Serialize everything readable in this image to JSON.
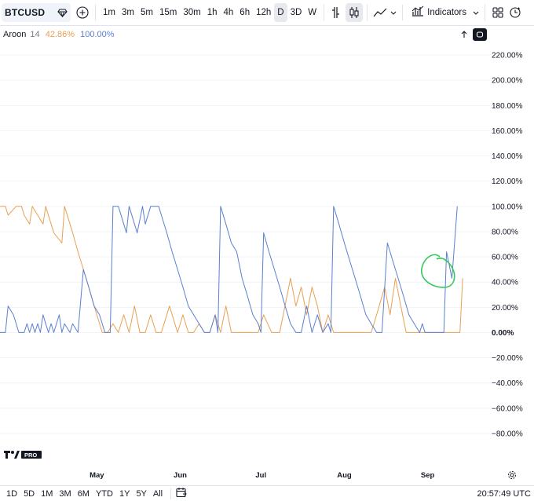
{
  "toolbar": {
    "symbol": "BTCUSD",
    "timeframes": [
      "1m",
      "3m",
      "5m",
      "15m",
      "30m",
      "1h",
      "4h",
      "6h",
      "12h",
      "D",
      "3D",
      "W"
    ],
    "active_timeframe": "D",
    "indicators_label": "Indicators"
  },
  "legend": {
    "name": "Aroon",
    "length": "14",
    "aroon_up": "42.86%",
    "aroon_down": "100.00%"
  },
  "colors": {
    "aroon_up": "#e8a052",
    "aroon_down": "#5b7fd1",
    "annotation": "#34c759",
    "grid": "#f0f3fa"
  },
  "chart_data": {
    "type": "line",
    "title": "",
    "ylim": [
      -90,
      230
    ],
    "y_ticks": [
      220,
      200,
      180,
      160,
      140,
      120,
      100,
      80,
      60,
      40,
      20,
      0,
      -20,
      -40,
      -60,
      -80
    ],
    "y_tick_labels": [
      "220.00%",
      "200.00%",
      "180.00%",
      "160.00%",
      "140.00%",
      "120.00%",
      "100.00%",
      "80.00%",
      "60.00%",
      "40.00%",
      "20.00%",
      "0.00%",
      "−20.00%",
      "−40.00%",
      "−60.00%",
      "−80.00%"
    ],
    "x_tick_labels": [
      {
        "label": "May",
        "day": 36
      },
      {
        "label": "Jun",
        "day": 67
      },
      {
        "label": "Jul",
        "day": 97
      },
      {
        "label": "Aug",
        "day": 128
      },
      {
        "label": "Sep",
        "day": 159
      }
    ],
    "x_range_days": [
      0,
      181
    ],
    "series": [
      {
        "name": "Aroon Up",
        "color": "#e8a052",
        "points": [
          [
            0,
            100
          ],
          [
            2,
            100
          ],
          [
            3,
            93
          ],
          [
            6,
            100
          ],
          [
            8,
            100
          ],
          [
            9,
            93
          ],
          [
            11,
            86
          ],
          [
            12,
            100
          ],
          [
            14,
            93
          ],
          [
            16,
            86
          ],
          [
            17,
            100
          ],
          [
            20,
            79
          ],
          [
            23,
            71
          ],
          [
            24,
            100
          ],
          [
            27,
            79
          ],
          [
            29,
            64
          ],
          [
            31,
            50
          ],
          [
            33,
            36
          ],
          [
            35,
            21
          ],
          [
            36,
            14
          ],
          [
            38,
            0
          ],
          [
            40,
            0
          ],
          [
            42,
            7
          ],
          [
            44,
            0
          ],
          [
            46,
            14
          ],
          [
            48,
            0
          ],
          [
            50,
            21
          ],
          [
            52,
            0
          ],
          [
            54,
            0
          ],
          [
            56,
            14
          ],
          [
            58,
            0
          ],
          [
            60,
            0
          ],
          [
            63,
            21
          ],
          [
            66,
            0
          ],
          [
            68,
            14
          ],
          [
            70,
            0
          ],
          [
            72,
            0
          ],
          [
            74,
            7
          ],
          [
            76,
            0
          ],
          [
            78,
            0
          ],
          [
            80,
            14
          ],
          [
            82,
            0
          ],
          [
            84,
            21
          ],
          [
            86,
            0
          ],
          [
            88,
            0
          ],
          [
            92,
            0
          ],
          [
            96,
            0
          ],
          [
            98,
            14
          ],
          [
            101,
            0
          ],
          [
            104,
            0
          ],
          [
            108,
            43
          ],
          [
            110,
            21
          ],
          [
            112,
            36
          ],
          [
            114,
            14
          ],
          [
            116,
            36
          ],
          [
            118,
            21
          ],
          [
            120,
            0
          ],
          [
            122,
            14
          ],
          [
            124,
            0
          ],
          [
            126,
            0
          ],
          [
            128,
            0
          ],
          [
            131,
            0
          ],
          [
            133,
            0
          ],
          [
            136,
            0
          ],
          [
            138,
            0
          ],
          [
            140,
            14
          ],
          [
            143,
            36
          ],
          [
            145,
            14
          ],
          [
            147,
            43
          ],
          [
            149,
            21
          ],
          [
            151,
            0
          ],
          [
            154,
            0
          ],
          [
            156,
            0
          ],
          [
            160,
            0
          ],
          [
            163,
            0
          ],
          [
            166,
            0
          ],
          [
            170,
            0
          ],
          [
            171,
            0
          ],
          [
            172,
            43
          ]
        ]
      },
      {
        "name": "Aroon Down",
        "color": "#5b7fd1",
        "points": [
          [
            0,
            0
          ],
          [
            2,
            0
          ],
          [
            3,
            21
          ],
          [
            5,
            14
          ],
          [
            7,
            0
          ],
          [
            9,
            0
          ],
          [
            10,
            7
          ],
          [
            11,
            0
          ],
          [
            12,
            7
          ],
          [
            13,
            0
          ],
          [
            14,
            7
          ],
          [
            15,
            0
          ],
          [
            16,
            14
          ],
          [
            17,
            7
          ],
          [
            18,
            0
          ],
          [
            19,
            7
          ],
          [
            20,
            0
          ],
          [
            22,
            14
          ],
          [
            23,
            0
          ],
          [
            24,
            7
          ],
          [
            26,
            0
          ],
          [
            27,
            7
          ],
          [
            29,
            0
          ],
          [
            31,
            50
          ],
          [
            33,
            36
          ],
          [
            35,
            21
          ],
          [
            37,
            14
          ],
          [
            39,
            0
          ],
          [
            41,
            0
          ],
          [
            42,
            100
          ],
          [
            44,
            100
          ],
          [
            46,
            86
          ],
          [
            47,
            79
          ],
          [
            48,
            100
          ],
          [
            50,
            86
          ],
          [
            51,
            79
          ],
          [
            53,
            100
          ],
          [
            54,
            86
          ],
          [
            56,
            100
          ],
          [
            57,
            100
          ],
          [
            59,
            100
          ],
          [
            60,
            93
          ],
          [
            62,
            79
          ],
          [
            64,
            64
          ],
          [
            66,
            50
          ],
          [
            68,
            36
          ],
          [
            70,
            21
          ],
          [
            72,
            14
          ],
          [
            74,
            7
          ],
          [
            76,
            0
          ],
          [
            78,
            0
          ],
          [
            80,
            14
          ],
          [
            81,
            0
          ],
          [
            82,
            100
          ],
          [
            84,
            86
          ],
          [
            86,
            71
          ],
          [
            88,
            64
          ],
          [
            90,
            43
          ],
          [
            92,
            29
          ],
          [
            94,
            14
          ],
          [
            96,
            7
          ],
          [
            97,
            0
          ],
          [
            98,
            79
          ],
          [
            100,
            64
          ],
          [
            102,
            50
          ],
          [
            104,
            36
          ],
          [
            106,
            21
          ],
          [
            108,
            7
          ],
          [
            110,
            0
          ],
          [
            112,
            0
          ],
          [
            114,
            21
          ],
          [
            116,
            0
          ],
          [
            118,
            14
          ],
          [
            120,
            0
          ],
          [
            122,
            7
          ],
          [
            123,
            0
          ],
          [
            124,
            100
          ],
          [
            126,
            86
          ],
          [
            128,
            71
          ],
          [
            130,
            57
          ],
          [
            132,
            43
          ],
          [
            134,
            29
          ],
          [
            136,
            14
          ],
          [
            138,
            7
          ],
          [
            140,
            0
          ],
          [
            142,
            0
          ],
          [
            144,
            71
          ],
          [
            146,
            57
          ],
          [
            148,
            43
          ],
          [
            150,
            29
          ],
          [
            152,
            14
          ],
          [
            154,
            7
          ],
          [
            156,
            0
          ],
          [
            157,
            7
          ],
          [
            158,
            0
          ],
          [
            160,
            0
          ],
          [
            163,
            0
          ],
          [
            165,
            0
          ],
          [
            166,
            64
          ],
          [
            168,
            43
          ],
          [
            170,
            100
          ]
        ]
      }
    ]
  },
  "time_axis": {
    "gear_icon": "gear-icon"
  },
  "bottom_bar": {
    "ranges": [
      "1D",
      "5D",
      "1M",
      "3M",
      "6M",
      "YTD",
      "1Y",
      "5Y",
      "All"
    ],
    "clock": "20:57:49 UTC"
  }
}
